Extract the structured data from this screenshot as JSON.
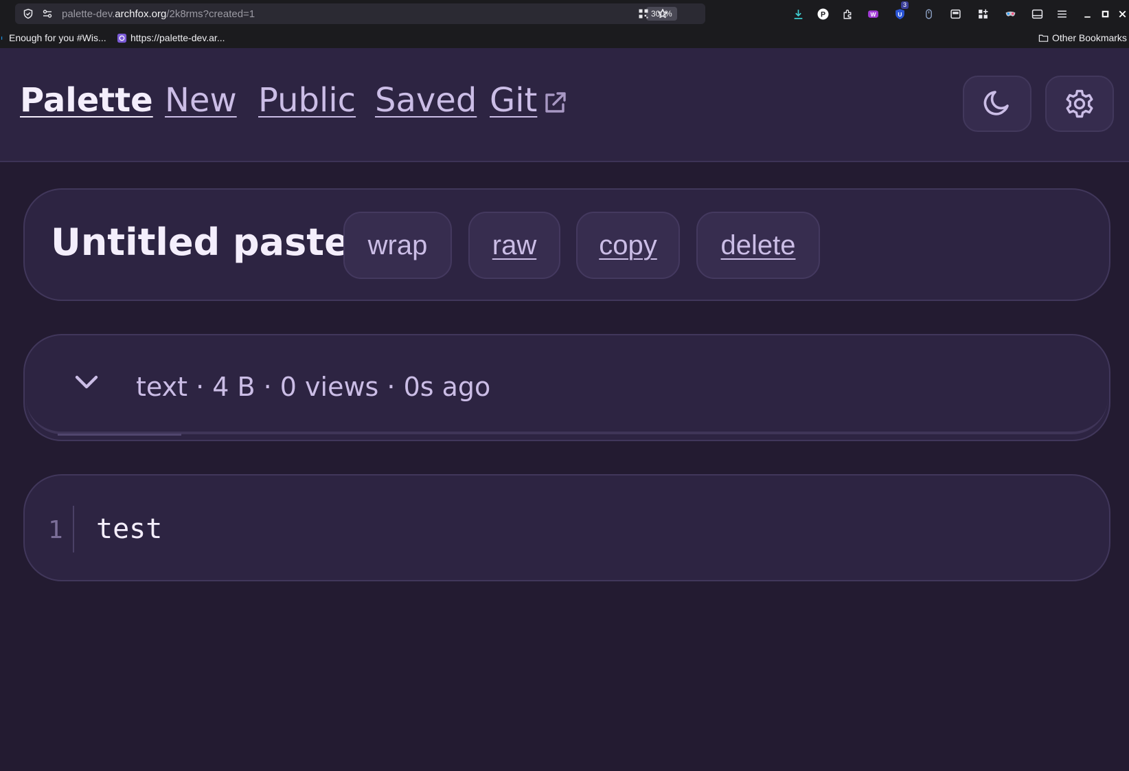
{
  "browser": {
    "url_prefix": "palette-dev.",
    "url_host": "archfox.org",
    "url_path": "/2k8rms?created=1",
    "zoom": "300%",
    "extension_badge": "3",
    "bookmarks": [
      {
        "label": "Enough for you #Wis..."
      },
      {
        "label": "https://palette-dev.ar..."
      }
    ],
    "other_bookmarks": "Other Bookmarks"
  },
  "nav": {
    "brand": "Palette",
    "links": [
      {
        "label": "New"
      },
      {
        "label": "Public"
      },
      {
        "label": "Saved"
      },
      {
        "label": "Git"
      }
    ]
  },
  "paste": {
    "title": "Untitled paste",
    "actions": {
      "wrap": "wrap",
      "raw": "raw",
      "copy": "copy",
      "delete": "delete"
    },
    "meta": "text · 4 B · 0 views · 0s ago",
    "lines": [
      {
        "number": "1",
        "text": "test"
      }
    ]
  },
  "colors": {
    "page_bg": "#231b31",
    "surface": "#2d2442",
    "accent_text": "#cbbde6",
    "heading_text": "#f4eefc"
  },
  "icons": [
    "shield-icon",
    "permissions-icon",
    "qr-code-icon",
    "bookmark-star-icon",
    "download-icon",
    "moon-icon",
    "settings-gear-icon",
    "external-link-icon",
    "chevron-down-icon"
  ]
}
